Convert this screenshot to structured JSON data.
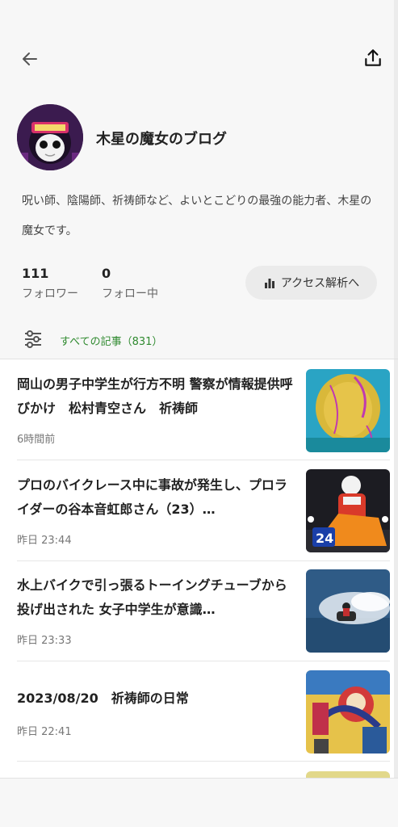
{
  "header": {
    "back_icon": "arrow-left-icon",
    "share_icon": "share-upload-icon"
  },
  "profile": {
    "avatar": "avatar",
    "blog_title": "木星の魔女のブログ",
    "description": "呪い師、陰陽師、祈祷師など、よいとこどりの最強の能力者、木星の魔女です。",
    "followers_count": "111",
    "followers_label": "フォロワー",
    "following_count": "0",
    "following_label": "フォロー中",
    "analytics_label": "アクセス解析へ",
    "analytics_icon": "bar-chart-icon"
  },
  "filter": {
    "icon": "sliders-icon",
    "all_articles_label": "すべての記事（831）"
  },
  "articles": [
    {
      "title": "岡山の男子中学生が行方不明 警察が情報提供呼びかけ　松村青空さん　祈祷師",
      "time": "6時間前"
    },
    {
      "title": "プロのバイクレース中に事故が発生し、プロライダーの谷本音虹郎さん（23）…",
      "time": "昨日 23:44"
    },
    {
      "title": "水上バイクで引っ張るトーイングチューブから投げ出された 女子中学生が意識…",
      "time": "昨日 23:33"
    },
    {
      "title": "2023/08/20　祈祷師の日常",
      "time": "昨日 22:41"
    }
  ],
  "colors": {
    "accent_green": "#2f8a2f",
    "header_bg": "#f7f7f7"
  }
}
